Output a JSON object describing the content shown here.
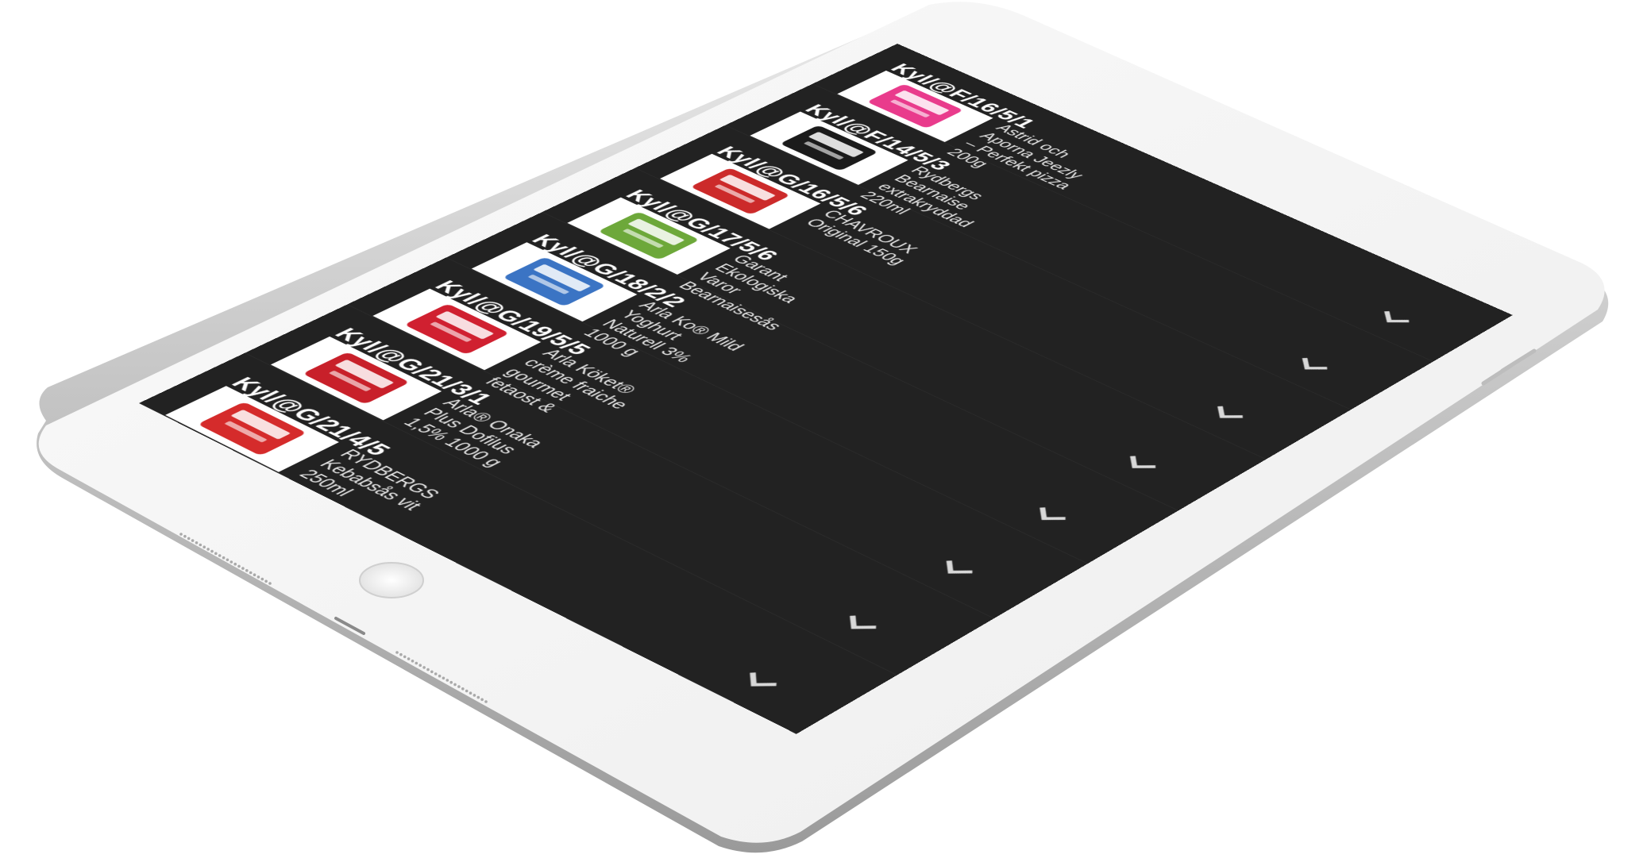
{
  "colors": {
    "screen_background": "#222222",
    "row_divider": "#2c2c2c",
    "code_text": "#ffffff",
    "name_text": "#e6e6e6",
    "chevron": "#d8d8d8",
    "device_body": "#f2f2f2"
  },
  "rows": [
    {
      "code": "Kyl/@F/16/5/1",
      "name": "Astrid och\nAporna Jeezly\n– Perfekt pizza\n200g",
      "thumb_icon": "pizza-box-icon",
      "thumb_color": "#e93b8c",
      "chevron_icon": "chevron-down-icon"
    },
    {
      "code": "Kyl/@F/14/5/3",
      "name": "Rydbergs\nBearnaise\nextrakryddad\n220ml",
      "thumb_icon": "sauce-bottle-icon",
      "thumb_color": "#1b1b1b",
      "chevron_icon": "chevron-down-icon"
    },
    {
      "code": "Kyl/@G/16/5/6",
      "name": "CHAVROUX\nOriginal 150g",
      "thumb_icon": "cheese-tub-icon",
      "thumb_color": "#cc2a2a",
      "chevron_icon": "chevron-down-icon"
    },
    {
      "code": "Kyl/@G/17/5/6",
      "name": "Garant\nEkologiska\nVaror\nBearnaisesås",
      "thumb_icon": "sauce-tub-icon",
      "thumb_color": "#6da83a",
      "chevron_icon": "chevron-down-icon"
    },
    {
      "code": "Kyl/@G/18/2/2",
      "name": "Arla Ko® Mild\nYoghurt\nNaturell 3%\n1000 g",
      "thumb_icon": "yoghurt-carton-icon",
      "thumb_color": "#3b74c4",
      "chevron_icon": "chevron-down-icon"
    },
    {
      "code": "Kyl/@G/19/5/5",
      "name": "Arla Köket®\ncrème fraiche\ngourmet\nfetaost &",
      "thumb_icon": "creme-fraiche-icon",
      "thumb_color": "#d02030",
      "chevron_icon": "chevron-down-icon"
    },
    {
      "code": "Kyl/@G/21/3/1",
      "name": "Arla® Onaka\nPlus Dofilus\n1,5% 1000 g",
      "thumb_icon": "milk-carton-icon",
      "thumb_color": "#c8202a",
      "chevron_icon": "chevron-down-icon"
    },
    {
      "code": "Kyl/@G/21/4/5",
      "name": "RYDBERGS\nKebabsås vit\n250ml",
      "thumb_icon": "kebab-sauce-bottle-icon",
      "thumb_color": "#d52b2b",
      "chevron_icon": "chevron-down-icon"
    }
  ]
}
